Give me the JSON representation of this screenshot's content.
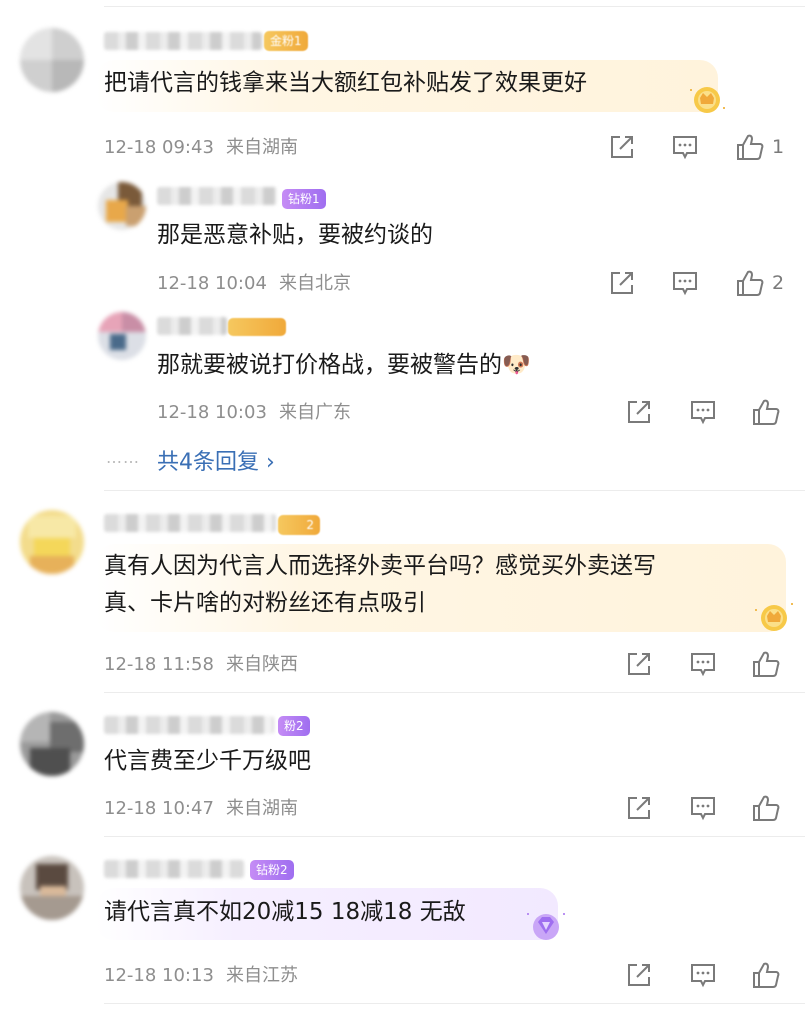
{
  "comments": [
    {
      "badge": "金粉1",
      "text": "把请代言的钱拿来当大额红包补贴发了效果更好",
      "time": "12-18 09:43",
      "location": "来自湖南",
      "likes": "1"
    },
    {
      "badge": "钻粉1",
      "text": "那是恶意补贴，要被约谈的",
      "time": "12-18 10:04",
      "location": "来自北京",
      "likes": "2"
    },
    {
      "badge": "",
      "text": "那就要被说打价格战，要被警告的🐶",
      "time": "12-18 10:03",
      "location": "来自广东",
      "likes": ""
    },
    {
      "badge": "2",
      "text_line1": "真有人因为代言人而选择外卖平台吗？感觉买外卖送写",
      "text_line2": "真、卡片啥的对粉丝还有点吸引",
      "time": "12-18 11:58",
      "location": "来自陕西",
      "likes": ""
    },
    {
      "badge": "粉2",
      "text": "代言费至少千万级吧",
      "time": "12-18 10:47",
      "location": "来自湖南",
      "likes": ""
    },
    {
      "badge": "钻粉2",
      "text": "请代言真不如20减15 18减18 无敌",
      "time": "12-18 10:13",
      "location": "来自江苏",
      "likes": ""
    }
  ],
  "more_replies": {
    "dots": "……",
    "label": "共4条回复 ›"
  },
  "colors": {
    "link": "#3a6fb5",
    "meta": "#8e8e8e",
    "gold_badge": "#f0a93a",
    "purple_badge": "#9f6ef0"
  },
  "icons": [
    "share-icon",
    "comment-icon",
    "like-icon",
    "gold-crown-icon",
    "purple-gem-icon"
  ]
}
